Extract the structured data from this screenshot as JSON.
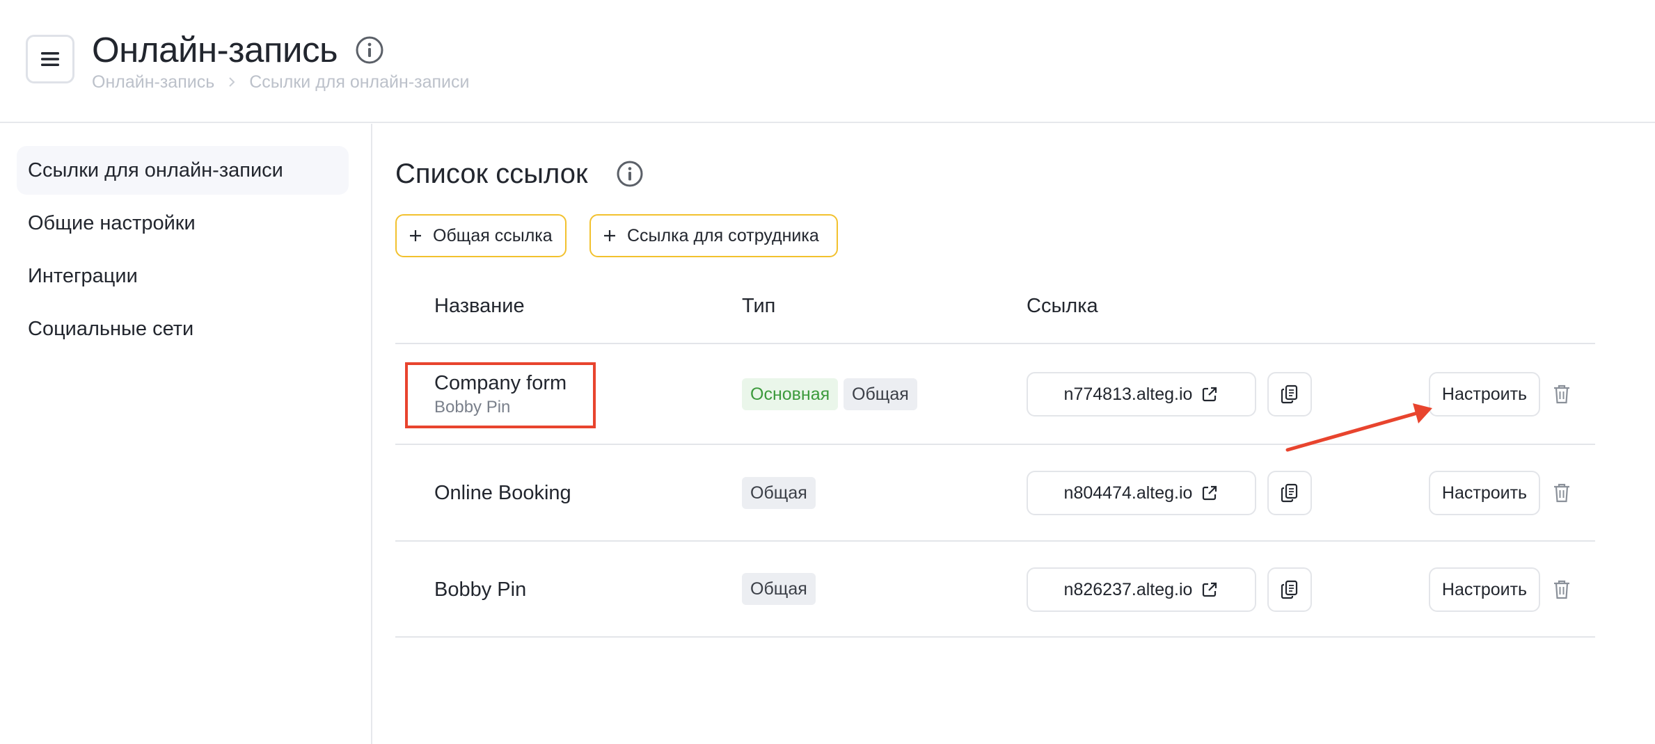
{
  "header": {
    "title": "Онлайн-запись",
    "breadcrumb": [
      "Онлайн-запись",
      "Ссылки для онлайн-записи"
    ]
  },
  "sidebar": {
    "items": [
      {
        "label": "Ссылки для онлайн-записи",
        "active": true
      },
      {
        "label": "Общие настройки",
        "active": false
      },
      {
        "label": "Интеграции",
        "active": false
      },
      {
        "label": "Социальные сети",
        "active": false
      }
    ]
  },
  "main": {
    "section_title": "Список ссылок",
    "buttons": {
      "add_general": "Общая ссылка",
      "add_employee": "Ссылка для сотрудника"
    },
    "columns": [
      "Название",
      "Тип",
      "Ссылка"
    ],
    "rows": [
      {
        "name": "Company form",
        "subtitle": "Bobby Pin",
        "badges": [
          "Основная",
          "Общая"
        ],
        "link": "n774813.alteg.io",
        "configure": "Настроить"
      },
      {
        "name": "Online Booking",
        "subtitle": "",
        "badges": [
          "Общая"
        ],
        "link": "n804474.alteg.io",
        "configure": "Настроить"
      },
      {
        "name": "Bobby Pin",
        "subtitle": "",
        "badges": [
          "Общая"
        ],
        "link": "n826237.alteg.io",
        "configure": "Настроить"
      }
    ]
  },
  "colors": {
    "accent_border": "#f2c12e",
    "badge_main_bg": "#eaf6ea",
    "badge_main_text": "#3c9a3c",
    "annotation": "#e8442e"
  },
  "icons": [
    "menu-icon",
    "info-icon",
    "chevron-right-icon",
    "plus-icon",
    "external-link-icon",
    "copy-icon",
    "trash-icon"
  ]
}
